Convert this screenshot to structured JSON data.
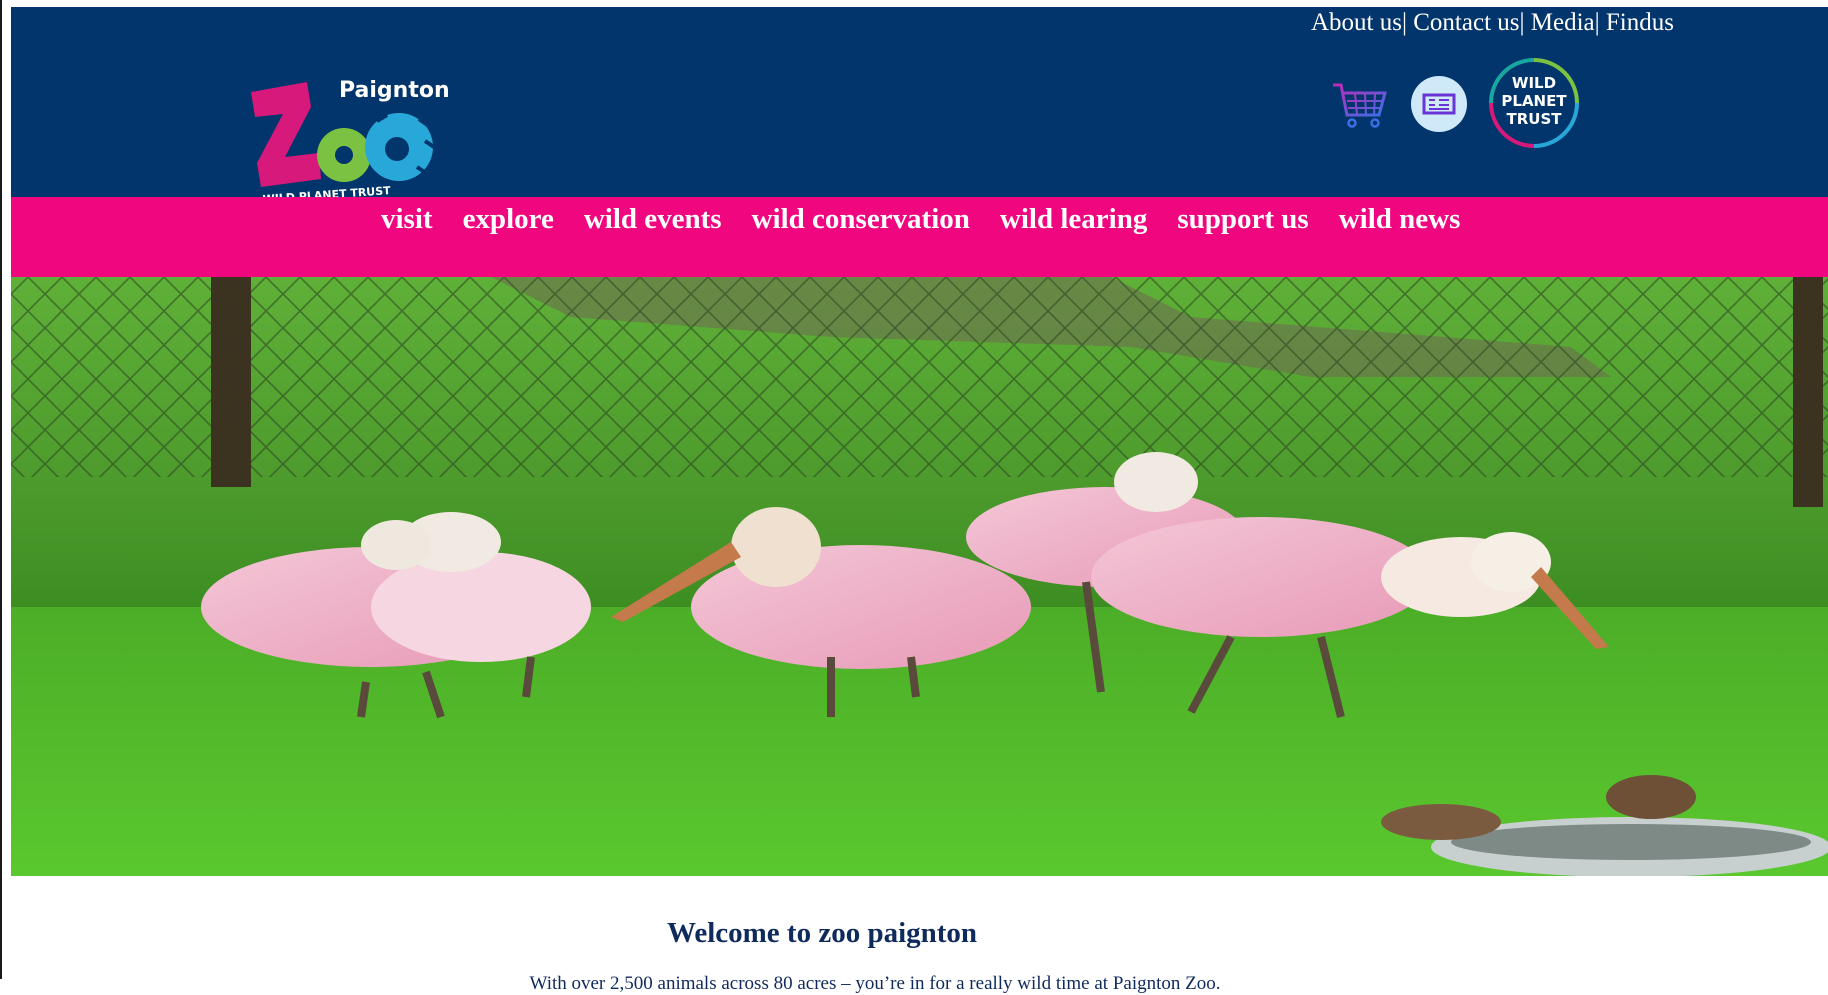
{
  "header": {
    "utility_links": [
      "About us",
      "Contact us",
      "Media",
      "Findus"
    ],
    "separator": "|",
    "logo": {
      "name": "Paignton",
      "wordmark": "Zoo",
      "tagline": "WILD PLANET TRUST"
    },
    "icons": [
      "shopping-cart-icon",
      "ticket-icon",
      "wild-planet-trust-badge"
    ],
    "badge_text": [
      "WILD",
      "PLANET",
      "TRUST"
    ]
  },
  "nav": {
    "items": [
      "visit",
      "explore",
      "wild events",
      "wild conservation",
      "wild learing",
      "support us",
      "wild news"
    ]
  },
  "hero": {
    "subject": "roseate spoonbills on grass behind chain-link fence"
  },
  "main": {
    "title": "Welcome to zoo paignton",
    "intro": "With over 2,500 animals across 80 acres – you’re in for a really wild time at Paignton Zoo."
  },
  "colors": {
    "header_bg": "#02356b",
    "nav_bg": "#f0067e",
    "heading_text": "#0f2a5c",
    "logo_pink": "#d6197a",
    "logo_green": "#7cc242",
    "logo_blue": "#27a8d8"
  }
}
